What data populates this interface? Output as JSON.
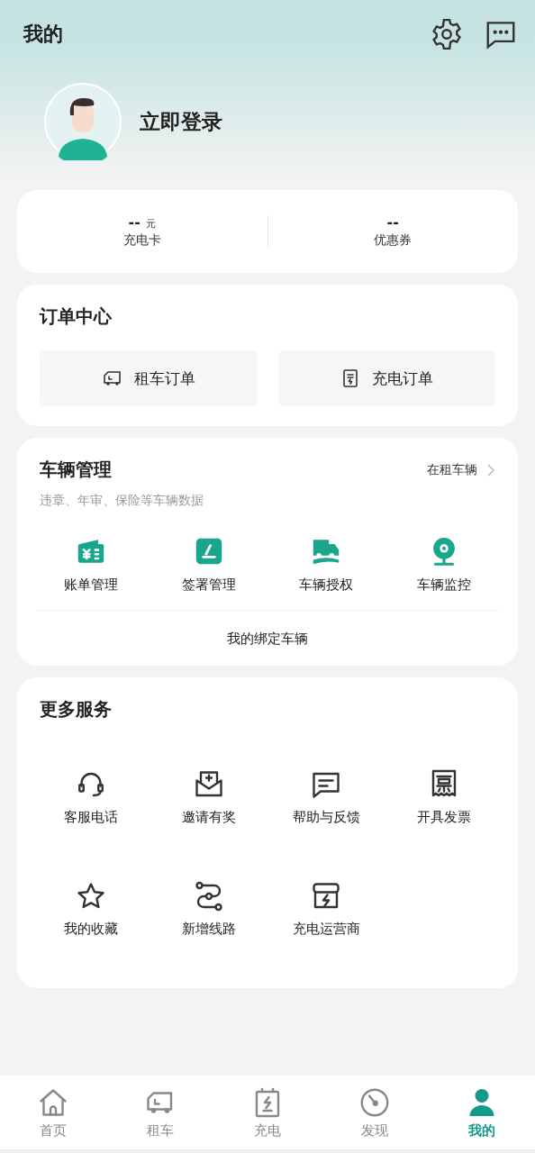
{
  "header": {
    "title": "我的",
    "login": "立即登录"
  },
  "stats": [
    {
      "value": "--",
      "unit": "元",
      "label": "充电卡"
    },
    {
      "value": "--",
      "label": "优惠券"
    }
  ],
  "orders": {
    "title": "订单中心",
    "buttons": [
      {
        "label": "租车订单"
      },
      {
        "label": "充电订单"
      }
    ]
  },
  "vehicles": {
    "title": "车辆管理",
    "link": "在租车辆",
    "subtitle": "违章、年审、保险等车辆数据",
    "items": [
      {
        "label": "账单管理"
      },
      {
        "label": "签署管理"
      },
      {
        "label": "车辆授权"
      },
      {
        "label": "车辆监控"
      }
    ],
    "footer": "我的绑定车辆"
  },
  "services": {
    "title": "更多服务",
    "items": [
      {
        "label": "客服电话"
      },
      {
        "label": "邀请有奖"
      },
      {
        "label": "帮助与反馈"
      },
      {
        "label": "开具发票"
      },
      {
        "label": "我的收藏"
      },
      {
        "label": "新增线路"
      },
      {
        "label": "充电运营商"
      }
    ]
  },
  "nav": [
    {
      "label": "首页",
      "selected": false
    },
    {
      "label": "租车",
      "selected": false
    },
    {
      "label": "充电",
      "selected": false
    },
    {
      "label": "发现",
      "selected": false
    },
    {
      "label": "我的",
      "selected": true
    }
  ]
}
